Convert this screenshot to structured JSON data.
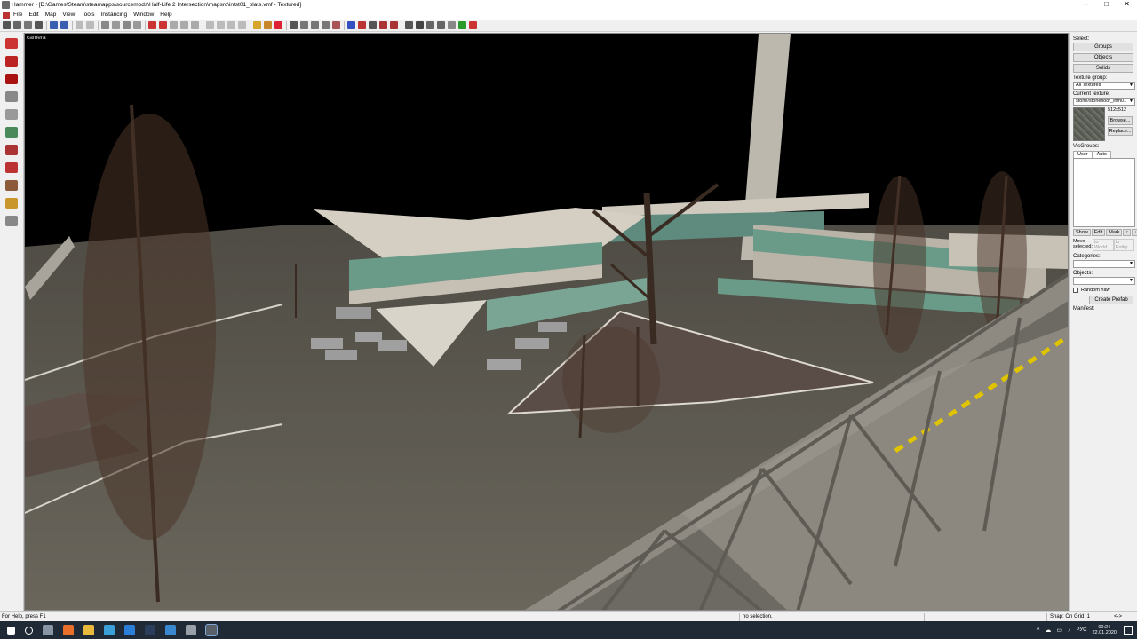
{
  "window": {
    "title": "Hammer - [D:\\Games\\Steam\\steamapps\\sourcemods\\Half-Life 2 Intersection\\mapsrc\\intst01_plats.vmf - Textured]",
    "controls": [
      "–",
      "□",
      "✕"
    ]
  },
  "menu": [
    "File",
    "Edit",
    "Map",
    "View",
    "Tools",
    "Instancing",
    "Window",
    "Help"
  ],
  "viewport": {
    "label": "camera"
  },
  "right_panel": {
    "select_label": "Select:",
    "select_buttons": [
      "Groups",
      "Objects",
      "Solids"
    ],
    "texture_group_label": "Texture group:",
    "texture_group_value": "All Textures",
    "current_texture_label": "Current texture:",
    "current_texture_value": "stone/stonefloor_inm01",
    "texture_size": "512x512",
    "browse_label": "Browse...",
    "replace_label": "Replace...",
    "visgroups_label": "VisGroups:",
    "visgroup_tabs": [
      "User",
      "Auto"
    ],
    "visgroup_buttons": [
      "Show",
      "Edit",
      "Mark",
      "↑",
      "↓"
    ],
    "move_selected_label": "Move selected:",
    "move_buttons": [
      "to World",
      "to Entity"
    ],
    "categories_label": "Categories:",
    "objects_label": "Objects:",
    "random_yaw_label": "Random Yaw",
    "create_prefab_label": "Create Prefab",
    "manifest_label": "Manifest:"
  },
  "status": {
    "help": "For Help, press F1",
    "selection": "no selection.",
    "snap": "Snap: On Grid: 1",
    "extra": "<->"
  },
  "taskbar": {
    "lang": "РУС",
    "time": "00:24",
    "date": "22.01.2020"
  },
  "colors": {
    "sky": "#000000",
    "ground": "#5f5c53",
    "building": "#c9c3b8",
    "glass": "#6f9d8c"
  }
}
